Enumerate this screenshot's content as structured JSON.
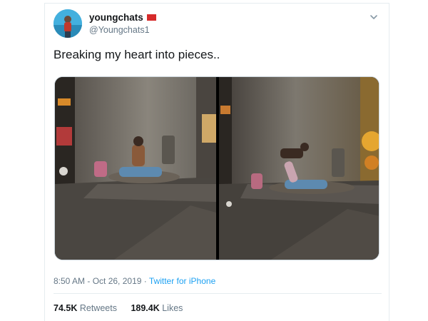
{
  "user": {
    "display_name": "youngchats",
    "handle": "@Youngchats1"
  },
  "tweet": {
    "text": "Breaking my heart into pieces.."
  },
  "icons": {
    "flag": "red-flag-emoji",
    "menu": "chevron-down-icon"
  },
  "meta": {
    "time": "8:50 AM",
    "separator1": " - ",
    "date": "Oct 26, 2019",
    "separator2": " · ",
    "source": "Twitter for iPhone"
  },
  "stats": {
    "retweets_count": "74.5K",
    "retweets_label": "Retweets",
    "likes_count": "189.4K",
    "likes_label": "Likes"
  },
  "colors": {
    "link": "#1da1f2",
    "secondary_text": "#657786",
    "border": "#e6ecf0"
  }
}
